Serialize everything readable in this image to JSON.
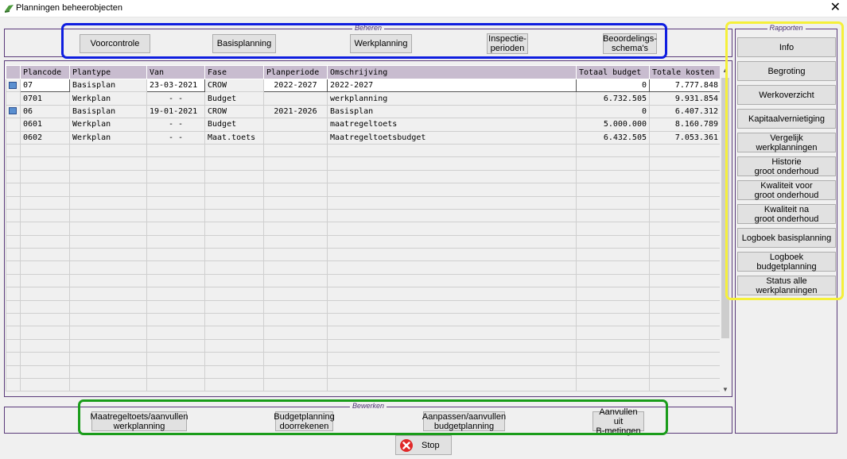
{
  "window": {
    "title": "Planningen beheerobjecten",
    "close": "✕"
  },
  "beheren": {
    "label": "Beheren",
    "buttons": [
      "Voorcontrole",
      "Basisplanning",
      "Werkplanning",
      "Inspectie-\nperioden",
      "Beoordelings-\nschema's"
    ]
  },
  "grid": {
    "columns": [
      "Plancode",
      "Plantype",
      "Van",
      "Fase",
      "Planperiode",
      "Omschrijving",
      "Totaal budget",
      "Totale kosten"
    ],
    "rows": [
      [
        "07",
        "Basisplan",
        "23-03-2021",
        "CROW",
        "2022-2027",
        "2022-2027",
        "0",
        "7.777.848"
      ],
      [
        "0701",
        "Werkplan",
        "-  -",
        "Budget",
        "",
        "werkplanning",
        "6.732.505",
        "9.931.854"
      ],
      [
        "06",
        "Basisplan",
        "19-01-2021",
        "CROW",
        "2021-2026",
        "Basisplan",
        "0",
        "6.407.312"
      ],
      [
        "0601",
        "Werkplan",
        "-  -",
        "Budget",
        "",
        "maatregeltoets",
        "5.000.000",
        "8.160.789"
      ],
      [
        "0602",
        "Werkplan",
        "-  -",
        "Maat.toets",
        "",
        "Maatregeltoetsbudget",
        "6.432.505",
        "7.053.361"
      ]
    ]
  },
  "rapporten": {
    "label": "Rapporten",
    "buttons": [
      "Info",
      "Begroting",
      "Werkoverzicht",
      "Kapitaalvernietiging",
      "Vergelijk\nwerkplanningen",
      "Historie\ngroot onderhoud",
      "Kwaliteit voor\ngroot onderhoud",
      "Kwaliteit na\ngroot onderhoud",
      "Logboek basisplanning",
      "Logboek budgetplanning",
      "Status alle\nwerkplanningen"
    ]
  },
  "bewerken": {
    "label": "Bewerken",
    "buttons": [
      "Maatregeltoets/aanvullen\nwerkplanning",
      "Budgetplanning\ndoorrekenen",
      "Aanpassen/aanvullen\nbudgetplanning",
      "Aanvullen uit\nB-metingen"
    ]
  },
  "stop": {
    "label": "Stop"
  },
  "colors": {
    "header": "#c8bccf",
    "group_border": "#5a3a7a",
    "blue": "#0f1ee0",
    "green": "#1a9c1a",
    "yellow": "#f5f03a",
    "stop_red": "#e02828"
  }
}
